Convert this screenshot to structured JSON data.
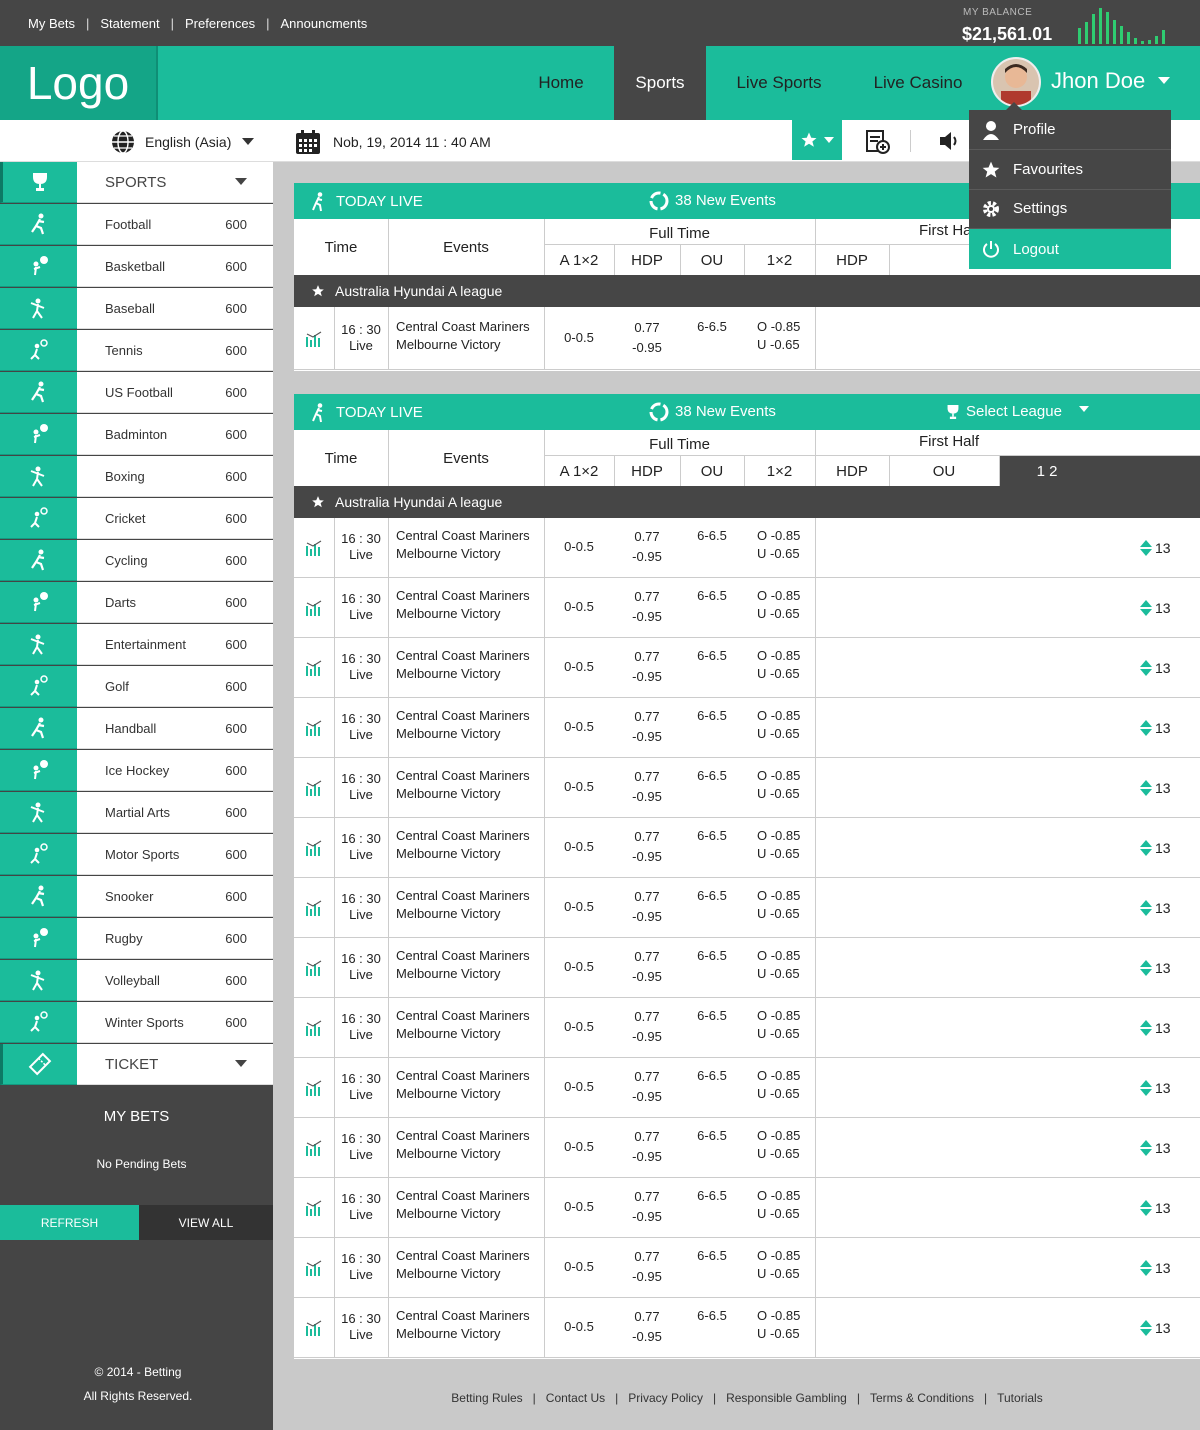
{
  "top_links": [
    "My Bets",
    "Statement",
    "Preferences",
    "Announcments"
  ],
  "balance": {
    "label": "MY BALANCE",
    "value": "$21,561.01"
  },
  "logo": "Logo",
  "nav": [
    "Home",
    "Sports",
    "Live Sports",
    "Live Casino"
  ],
  "user": {
    "name": "Jhon Doe"
  },
  "dropdown": [
    "Profile",
    "Favourites",
    "Settings",
    "Logout"
  ],
  "toolbar": {
    "language": "English (Asia)",
    "datetime": "Nob, 19, 2014 11 : 40 AM"
  },
  "sidebar": {
    "sports_header": "SPORTS",
    "sports": [
      {
        "name": "Football",
        "count": "600"
      },
      {
        "name": "Basketball",
        "count": "600"
      },
      {
        "name": "Baseball",
        "count": "600"
      },
      {
        "name": "Tennis",
        "count": "600"
      },
      {
        "name": "US Football",
        "count": "600"
      },
      {
        "name": "Badminton",
        "count": "600"
      },
      {
        "name": "Boxing",
        "count": "600"
      },
      {
        "name": "Cricket",
        "count": "600"
      },
      {
        "name": "Cycling",
        "count": "600"
      },
      {
        "name": "Darts",
        "count": "600"
      },
      {
        "name": "Entertainment",
        "count": "600"
      },
      {
        "name": "Golf",
        "count": "600"
      },
      {
        "name": "Handball",
        "count": "600"
      },
      {
        "name": "Ice Hockey",
        "count": "600"
      },
      {
        "name": "Martial Arts",
        "count": "600"
      },
      {
        "name": "Motor Sports",
        "count": "600"
      },
      {
        "name": "Snooker",
        "count": "600"
      },
      {
        "name": "Rugby",
        "count": "600"
      },
      {
        "name": "Volleyball",
        "count": "600"
      },
      {
        "name": "Winter Sports",
        "count": "600"
      }
    ],
    "ticket_header": "TICKET",
    "my_bets_title": "MY BETS",
    "no_pending": "No Pending Bets",
    "refresh": "REFRESH",
    "view_all": "VIEW ALL",
    "copyright": "© 2014 - Betting",
    "rights": "All Rights Reserved."
  },
  "panels": {
    "title": "TODAY LIVE",
    "new_events": "38 New Events",
    "select_league": "Select League",
    "headers": {
      "time": "Time",
      "events": "Events",
      "full_time": "Full Time",
      "first_half": "First Half",
      "a12": "A 1×2",
      "hdp": "HDP",
      "ou": "OU",
      "one_x_two": "1×2",
      "one_two": "1  2"
    },
    "league": "Australia Hyundai A league",
    "match": {
      "time": "16 : 30",
      "status": "Live",
      "home": "Central Coast Mariners",
      "away": "Melbourne Victory",
      "a12": "0-0.5",
      "hdp_top": "0.77",
      "hdp_bottom": "-0.95",
      "ou": "6-6.5",
      "over": "O  -0.85",
      "under": "U  -0.65",
      "more": "13"
    },
    "first_rows": 1,
    "second_rows": 14
  },
  "footer": [
    "Betting Rules",
    "Contact Us",
    "Privacy Policy",
    "Responsible Gambling",
    "Terms & Conditions",
    "Tutorials"
  ],
  "colors": {
    "accent": "#1bbc9b",
    "dark": "#464646"
  }
}
